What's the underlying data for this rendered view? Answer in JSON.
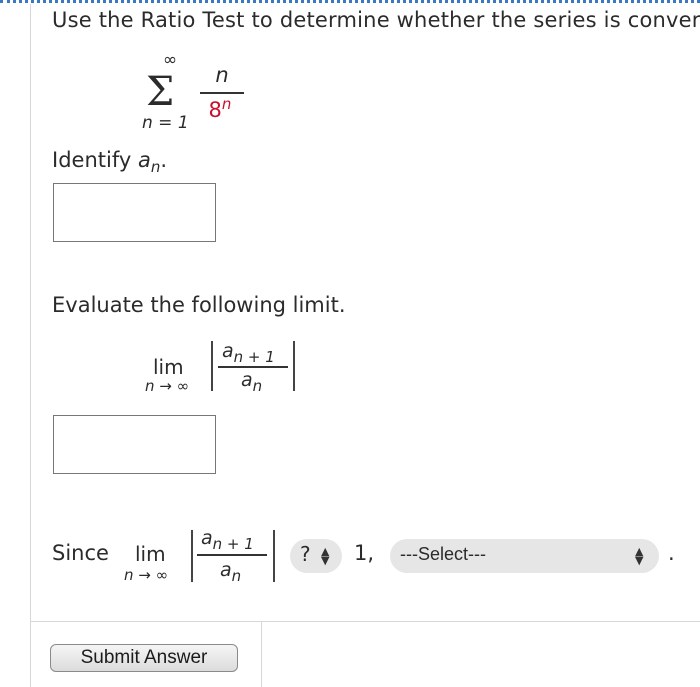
{
  "question": {
    "intro": "Use the Ratio Test to determine whether the series is conver",
    "series": {
      "sum_upper": "∞",
      "sum_lower": "n = 1",
      "numerator": "n",
      "denominator_base": "8",
      "denominator_exp": "n"
    },
    "identify_label": "Identify",
    "identify_var": "a",
    "identify_sub": "n",
    "identify_period": ".",
    "answer1_value": "",
    "evaluate_label": "Evaluate the following limit.",
    "limit": {
      "word": "lim",
      "sub": "n → ∞",
      "num_var": "a",
      "num_sub": "n + 1",
      "den_var": "a",
      "den_sub": "n"
    },
    "answer2_value": "",
    "since_label": "Since",
    "comparison_select": "?",
    "one_text": "1,",
    "conclusion_select": "---Select---",
    "final_period": "."
  },
  "submit_label": "Submit Answer"
}
